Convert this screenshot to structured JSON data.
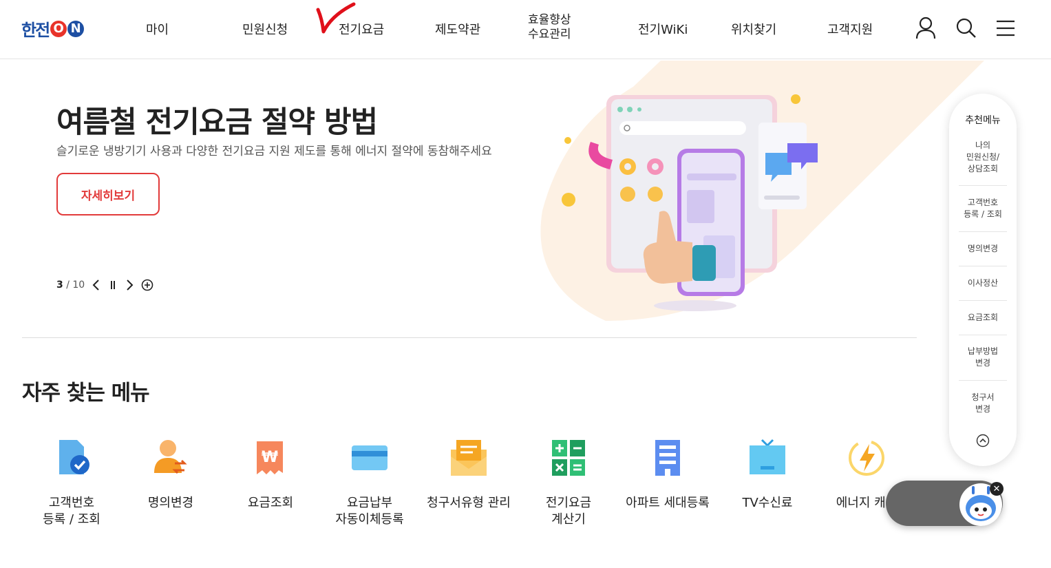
{
  "brand": {
    "logo_text": "한전",
    "logo_on": [
      "O",
      "N"
    ]
  },
  "nav": {
    "items": [
      "마이",
      "민원신청",
      "전기요금",
      "제도약관"
    ],
    "efficiency": [
      "효율향상",
      "수요관리"
    ],
    "items2": [
      "전기WiKi",
      "위치찾기",
      "고객지원"
    ],
    "icons": [
      "user-icon",
      "search-icon",
      "menu-icon"
    ]
  },
  "hero": {
    "title": "여름철 전기요금 절약 방법",
    "subtitle": "슬기로운 냉방기기 사용과 다양한 전기요금 지원 제도를 통해 에너지 절약에 동참해주세요",
    "button": "자세히보기",
    "current": "3",
    "total": "/ 10"
  },
  "frequent": {
    "title": "자주 찾는 메뉴",
    "items": [
      {
        "label": "고객번호\n등록 / 조회",
        "icon": "customer-id-icon"
      },
      {
        "label": "명의변경",
        "icon": "name-change-icon"
      },
      {
        "label": "요금조회",
        "icon": "bill-inquiry-icon"
      },
      {
        "label": "요금납부\n자동이체등록",
        "icon": "card-icon"
      },
      {
        "label": "청구서유형 관리",
        "icon": "envelope-icon"
      },
      {
        "label": "전기요금\n계산기",
        "icon": "calculator-icon"
      },
      {
        "label": "아파트 세대등록",
        "icon": "apartment-icon"
      },
      {
        "label": "TV수신료",
        "icon": "tv-icon"
      },
      {
        "label": "에너지 캐시",
        "icon": "energy-cash-icon"
      }
    ]
  },
  "side": {
    "title": "추천메뉴",
    "items": [
      "나의\n민원신청/\n상담조회",
      "고객번호\n등록 / 조회",
      "명의변경",
      "이사정산",
      "요금조회",
      "납부방법\n변경",
      "청구서\n변경"
    ]
  },
  "colors": {
    "brand_blue": "#1d4fa3",
    "brand_red": "#e23a3a",
    "annotation_red": "#e0101a"
  }
}
